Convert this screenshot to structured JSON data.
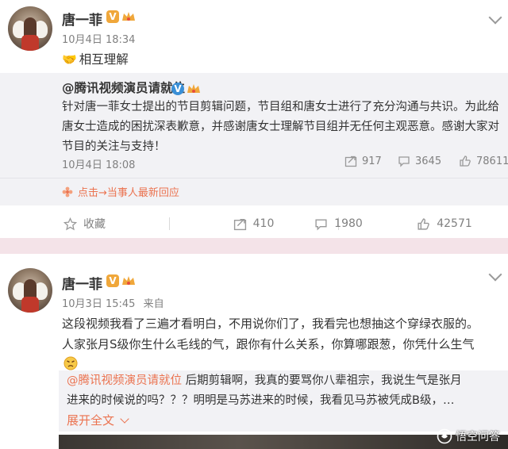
{
  "post1": {
    "author": "唐一菲",
    "time": "10月4日 18:34",
    "content": "相互理解",
    "repost": {
      "author_mention": "@腾讯视频演员请就位",
      "text": "针对唐一菲女士提出的节目剪辑问题，节目组和唐女士进行了充分沟通与共识。为此给唐女士造成的困扰深表歉意，并感谢唐女士理解节目组并无任何主观恶意。感谢大家对节目的关注与支持！",
      "time": "10月4日 18:08",
      "reposts": "917",
      "comments": "3645",
      "likes": "78611"
    },
    "hot_link": "点击→当事人最新回应",
    "actions": {
      "favorite": "收藏",
      "repost": "410",
      "comment": "1980",
      "like": "42571"
    }
  },
  "post2": {
    "author": "唐一菲",
    "time": "10月3日 15:45",
    "source": "来自",
    "content_line1": "这段视频我看了三遍才看明白，不用说你们了，我看完也想抽这个穿绿衣服的。",
    "content_line2": "人家张月S级你生什么毛线的气，跟你有什么关系，你算哪跟葱，你凭什么生气",
    "quote_mention": "@腾讯视频演员请就位",
    "quote_text1": " 后期剪辑啊，我真的要骂你八辈祖宗，我说生气是张月",
    "quote_text2": "进来的时候说的吗？？？明明是马苏进来的时候，我看见马苏被凭成B级，…",
    "expand": "展开全文",
    "watermark": "悟空问答"
  },
  "colors": {
    "accent": "#eb7350",
    "badge": "#f0a73a",
    "separator": "#f4e3e8",
    "repost_bg": "#f2f2f5"
  }
}
